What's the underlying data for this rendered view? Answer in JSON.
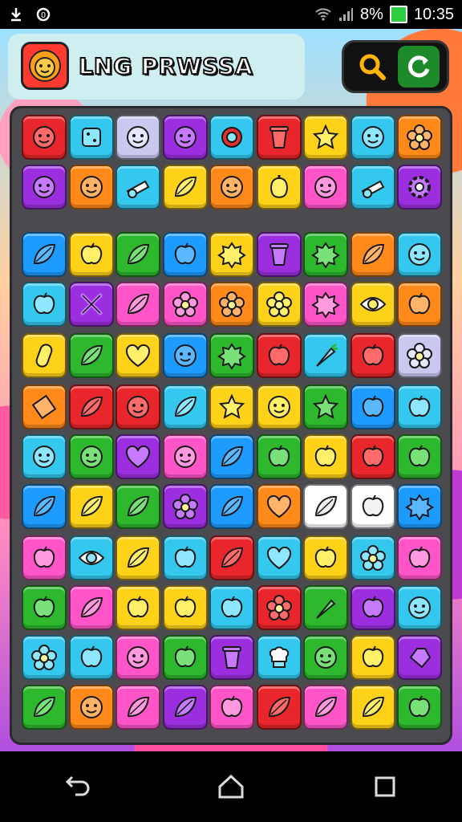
{
  "status": {
    "percent": "8%",
    "time": "10:35"
  },
  "header": {
    "title": "LNG PRWSSA",
    "icons": [
      "lion-face-icon",
      "search-icon",
      "refresh-icon"
    ]
  },
  "colors": {
    "red": "#e8262b",
    "blue": "#1e9bff",
    "cyan": "#35c8ee",
    "green": "#2eb82e",
    "yellow": "#ffd21a",
    "orange": "#ff8a1a",
    "purple": "#9b2fe0",
    "pink": "#ff55c8",
    "lavender": "#c9c9f0",
    "white": "#ffffff",
    "gray": "#7a7a7a"
  },
  "board": {
    "rows": [
      [
        "red",
        "cyan",
        "lavender",
        "purple",
        "cyan",
        "red",
        "yellow",
        "cyan",
        "orange"
      ],
      [
        "purple",
        "orange",
        "cyan",
        "yellow",
        "orange",
        "yellow",
        "pink",
        "cyan",
        "purple"
      ],
      [
        "blue",
        "yellow",
        "green",
        "blue",
        "yellow",
        "purple",
        "green",
        "orange",
        "cyan"
      ],
      [
        "cyan",
        "purple",
        "pink",
        "pink",
        "orange",
        "yellow",
        "pink",
        "yellow",
        "orange"
      ],
      [
        "yellow",
        "green",
        "yellow",
        "blue",
        "green",
        "red",
        "cyan",
        "red",
        "lavender"
      ],
      [
        "orange",
        "red",
        "red",
        "cyan",
        "yellow",
        "yellow",
        "green",
        "blue",
        "cyan"
      ],
      [
        "cyan",
        "green",
        "purple",
        "pink",
        "blue",
        "green",
        "yellow",
        "red",
        "green"
      ],
      [
        "blue",
        "yellow",
        "green",
        "purple",
        "blue",
        "orange",
        "white",
        "white",
        "blue"
      ],
      [
        "pink",
        "cyan",
        "yellow",
        "cyan",
        "red",
        "cyan",
        "yellow",
        "cyan",
        "pink"
      ],
      [
        "green",
        "pink",
        "yellow",
        "yellow",
        "cyan",
        "red",
        "green",
        "purple",
        "cyan"
      ],
      [
        "cyan",
        "cyan",
        "pink",
        "green",
        "purple",
        "cyan",
        "green",
        "yellow",
        "purple"
      ],
      [
        "green",
        "orange",
        "pink",
        "purple",
        "pink",
        "red",
        "pink",
        "yellow",
        "green"
      ]
    ],
    "icons": [
      [
        "face-icon",
        "cheese-icon",
        "face-icon",
        "face-icon",
        "ring-icon",
        "bucket-icon",
        "star-icon",
        "face-icon",
        "flower-icon"
      ],
      [
        "face-icon",
        "face-icon",
        "cannon-icon",
        "leaf-icon",
        "face-icon",
        "pepper-icon",
        "face-icon",
        "cannon-icon",
        "gear-icon"
      ],
      [
        "leaf-icon",
        "apple-icon",
        "leaf-icon",
        "apple-icon",
        "splat-icon",
        "bucket-icon",
        "splat-icon",
        "leaf-icon",
        "face-icon"
      ],
      [
        "apple-icon",
        "cross-icon",
        "leaf-icon",
        "flower-icon",
        "flower-icon",
        "flower-icon",
        "splat-icon",
        "eye-icon",
        "apple-icon"
      ],
      [
        "pickle-icon",
        "leaf-icon",
        "heart-icon",
        "face-icon",
        "splat-icon",
        "apple-icon",
        "carrot-icon",
        "apple-icon",
        "flower-icon"
      ],
      [
        "card-icon",
        "leaf-icon",
        "face-icon",
        "leaf-icon",
        "star-icon",
        "face-icon",
        "star-icon",
        "apple-icon",
        "apple-icon"
      ],
      [
        "face-icon",
        "face-icon",
        "heart-icon",
        "face-icon",
        "leaf-icon",
        "apple-icon",
        "apple-icon",
        "apple-icon",
        "apple-icon"
      ],
      [
        "leaf-icon",
        "leaf-icon",
        "leaf-icon",
        "flower-icon",
        "leaf-icon",
        "heart-icon",
        "leaf-icon",
        "apple-icon",
        "splat-icon"
      ],
      [
        "apple-icon",
        "eye-icon",
        "leaf-icon",
        "apple-icon",
        "leaf-icon",
        "heart-icon",
        "apple-icon",
        "flower-icon",
        "apple-icon"
      ],
      [
        "apple-icon",
        "leaf-icon",
        "apple-icon",
        "apple-icon",
        "apple-icon",
        "flower-icon",
        "carrot-icon",
        "apple-icon",
        "face-icon"
      ],
      [
        "flower-icon",
        "apple-icon",
        "face-icon",
        "apple-icon",
        "bucket-icon",
        "chef-icon",
        "face-icon",
        "apple-icon",
        "gem-icon"
      ],
      [
        "leaf-icon",
        "face-icon",
        "leaf-icon",
        "leaf-icon",
        "apple-icon",
        "leaf-icon",
        "leaf-icon",
        "leaf-icon",
        "apple-icon"
      ]
    ]
  },
  "nav": {
    "icons": [
      "back-icon",
      "home-icon",
      "recents-icon"
    ]
  }
}
